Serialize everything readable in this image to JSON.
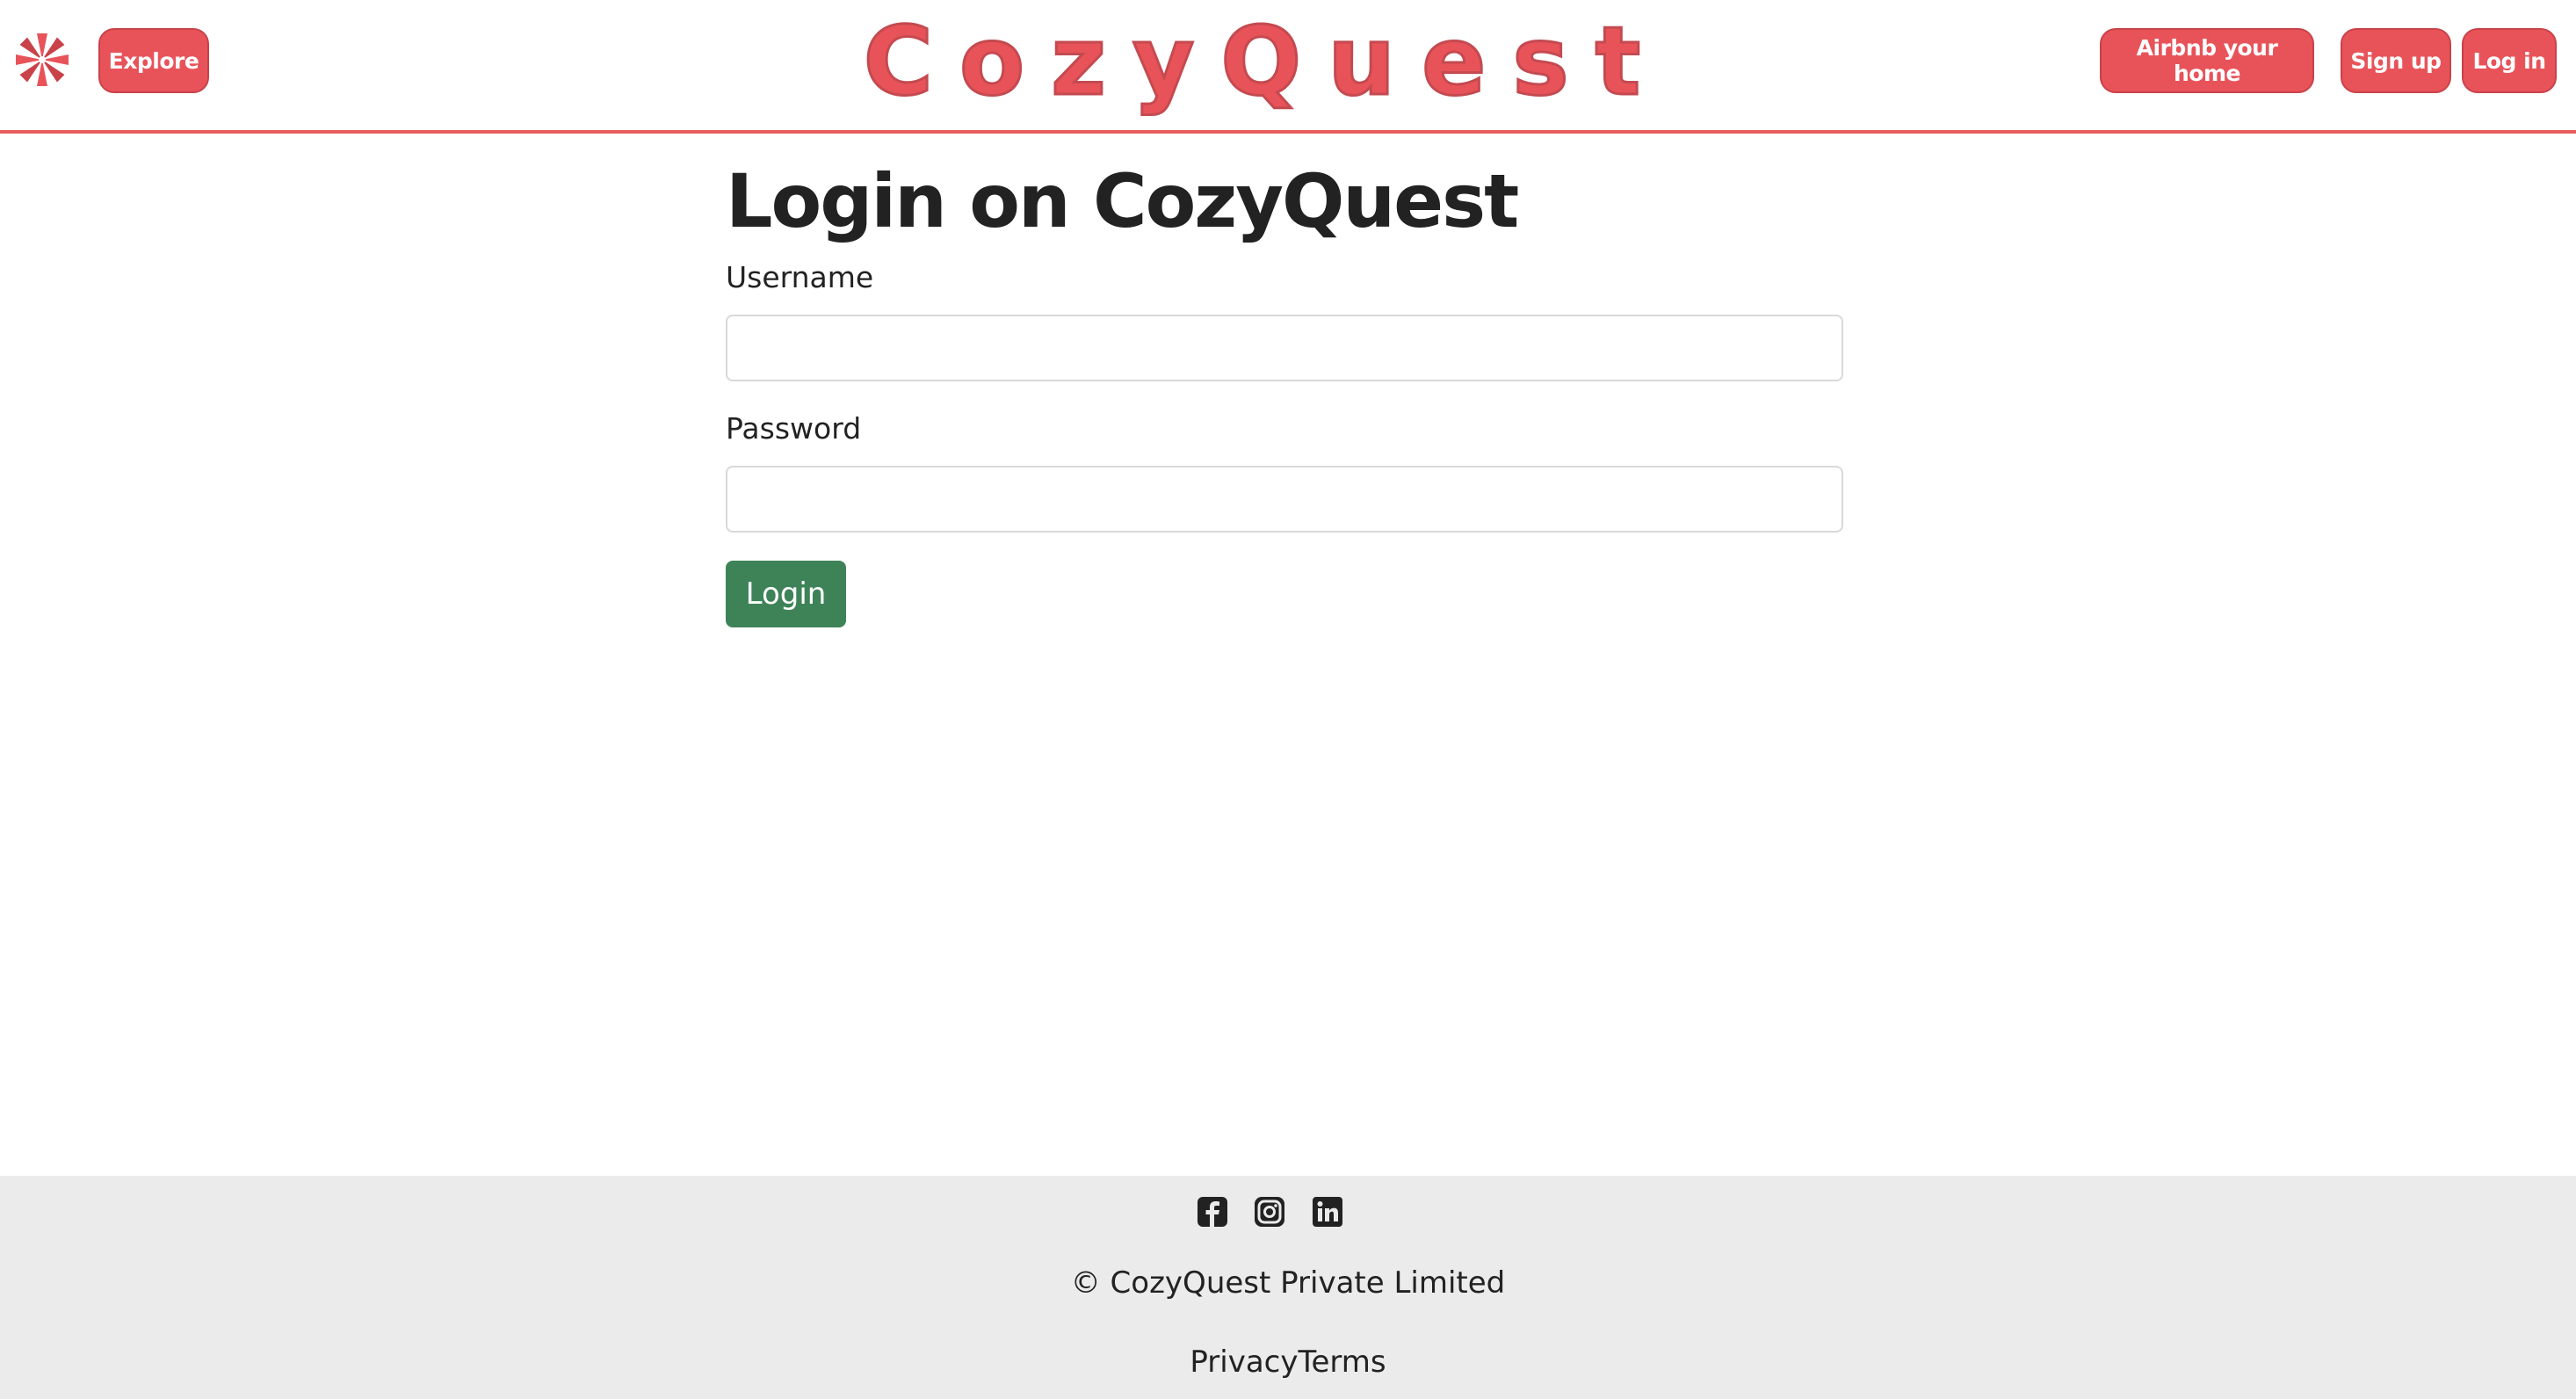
{
  "header": {
    "brand": "CozyQuest",
    "explore_label": "Explore",
    "host_label": "Airbnb your home",
    "signup_label": "Sign up",
    "login_label": "Log in",
    "logo_icon": "compass-icon",
    "accent_color": "#e8535a"
  },
  "main": {
    "title": "Login on CozyQuest",
    "username_label": "Username",
    "username_value": "",
    "password_label": "Password",
    "password_value": "",
    "submit_label": "Login",
    "submit_color": "#3e8358"
  },
  "footer": {
    "social_icons": [
      "facebook-icon",
      "instagram-icon",
      "linkedin-icon"
    ],
    "copyright": "© CozyQuest Private Limited",
    "privacy_label": "Privacy",
    "terms_label": "Terms"
  }
}
